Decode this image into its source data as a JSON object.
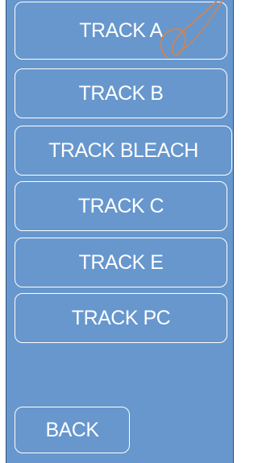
{
  "menu": {
    "items": [
      {
        "label": "TRACK A"
      },
      {
        "label": "TRACK B"
      },
      {
        "label": "TRACK BLEACH"
      },
      {
        "label": "TRACK C"
      },
      {
        "label": "TRACK E"
      },
      {
        "label": "TRACK PC"
      }
    ],
    "back_label": "BACK"
  },
  "colors": {
    "panel": "#6797cd",
    "button_border": "#ffffff",
    "text": "#ffffff",
    "scribble": "#c9855b"
  }
}
